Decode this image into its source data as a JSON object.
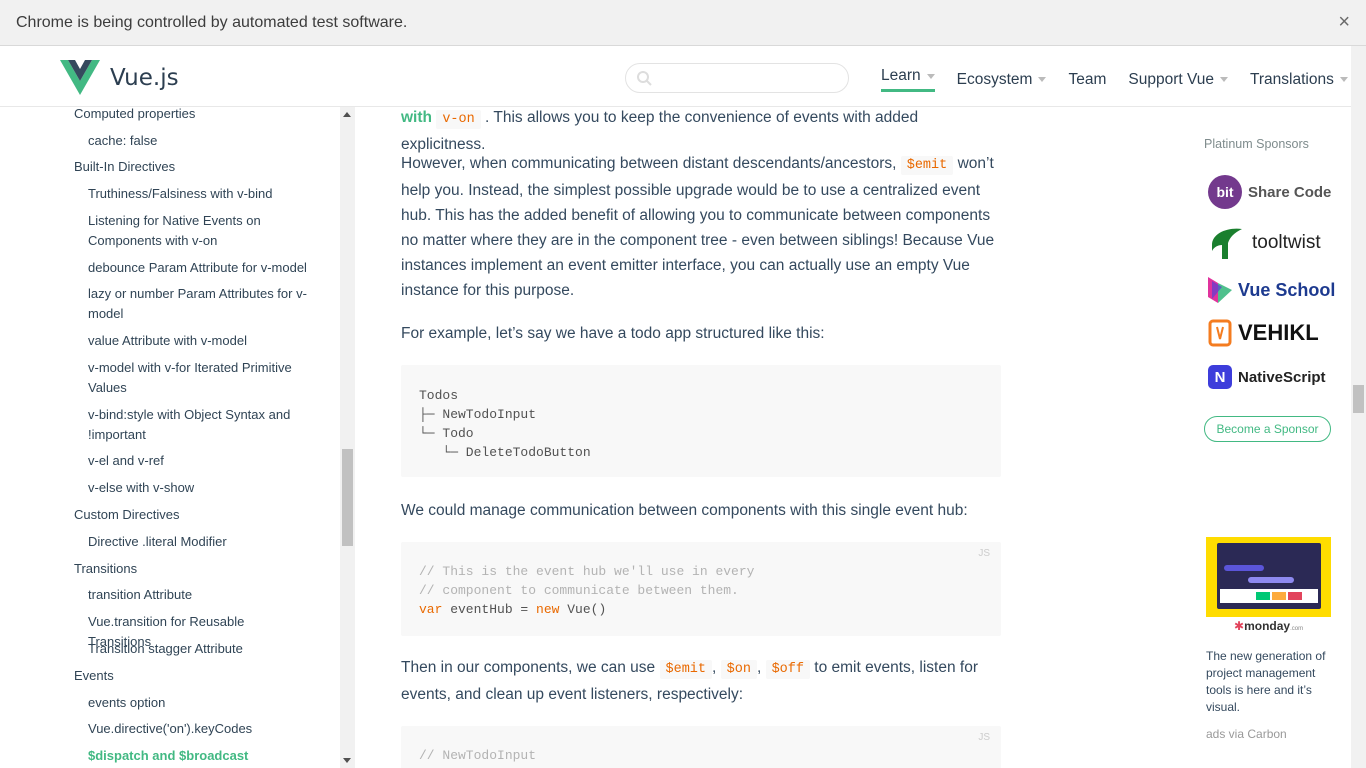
{
  "infobar": {
    "message": "Chrome is being controlled by automated test software.",
    "close_glyph": "×"
  },
  "header": {
    "brand": "Vue.js",
    "search_placeholder": "",
    "nav": [
      {
        "label": "Learn",
        "has_caret": true,
        "active": true
      },
      {
        "label": "Ecosystem",
        "has_caret": true
      },
      {
        "label": "Team",
        "has_caret": false
      },
      {
        "label": "Support Vue",
        "has_caret": true
      },
      {
        "label": "Translations",
        "has_caret": true
      }
    ]
  },
  "sidebar": {
    "items": [
      {
        "label": "Computed properties",
        "level": "section"
      },
      {
        "label": "cache: false",
        "level": "sub"
      },
      {
        "label": "Built-In Directives",
        "level": "section"
      },
      {
        "label": "Truthiness/Falsiness with v-bind",
        "level": "sub"
      },
      {
        "label": "Listening for Native Events on Components with v-on",
        "level": "sub"
      },
      {
        "label": "debounce Param Attribute for v-model",
        "level": "sub"
      },
      {
        "label": "lazy or number Param Attributes for v-model",
        "level": "sub"
      },
      {
        "label": "value Attribute with v-model",
        "level": "sub"
      },
      {
        "label": "v-model with v-for Iterated Primitive Values",
        "level": "sub"
      },
      {
        "label": "v-bind:style with Object Syntax and !important",
        "level": "sub"
      },
      {
        "label": "v-el and v-ref",
        "level": "sub"
      },
      {
        "label": "v-else with v-show",
        "level": "sub"
      },
      {
        "label": "Custom Directives",
        "level": "section"
      },
      {
        "label": "Directive .literal Modifier",
        "level": "sub"
      },
      {
        "label": "Transitions",
        "level": "section"
      },
      {
        "label": "transition Attribute",
        "level": "sub"
      },
      {
        "label": "Vue.transition for Reusable Transitions",
        "level": "sub"
      },
      {
        "label": "Transition stagger Attribute",
        "level": "sub"
      },
      {
        "label": "Events",
        "level": "section"
      },
      {
        "label": "events option",
        "level": "sub"
      },
      {
        "label": "Vue.directive('on').keyCodes",
        "level": "sub"
      },
      {
        "label": "$dispatch and $broadcast",
        "level": "sub",
        "active": true
      }
    ]
  },
  "content": {
    "p0": {
      "link_text": "with",
      "code": "v-on",
      "rest": ". This allows you to keep the convenience of events with added explicitness."
    },
    "p1": {
      "before": "However, when communicating between distant descendants/ancestors,",
      "code": "$emit",
      "after": "won’t help you. Instead, the simplest possible upgrade would be to use a centralized event hub. This has the added benefit of allowing you to communicate between components no matter where they are in the component tree - even between siblings! Because Vue instances implement an event emitter interface, you can actually use an empty Vue instance for this purpose."
    },
    "p2": "For example, let’s say we have a todo app structured like this:",
    "tree": [
      "Todos",
      "├─ NewTodoInput",
      "└─ Todo",
      "   └─ DeleteTodoButton"
    ],
    "p3": "We could manage communication between components with this single event hub:",
    "code1": {
      "lang": "JS",
      "comment1": "// This is the event hub we'll use in every",
      "comment2": "// component to communicate between them.",
      "kw_var": "var",
      "mid": " eventHub = ",
      "kw_new": "new",
      "end": " Vue()"
    },
    "p4": {
      "before": "Then in our components, we can use",
      "code1": "$emit",
      "sep1": ",",
      "code2": "$on",
      "sep2": ",",
      "code3": "$off",
      "after": "to emit events, listen for events, and clean up event listeners, respectively:"
    },
    "code2": {
      "lang": "JS",
      "comment": "// NewTodoInput"
    }
  },
  "aside": {
    "title": "Platinum Sponsors",
    "sponsors": [
      {
        "name": "Share Code",
        "badge": "bit",
        "icon": "bit-logo-icon",
        "color": "#73398d"
      },
      {
        "name": "tooltwist",
        "icon": "tooltwist-logo-icon",
        "color": "#1a7f2e"
      },
      {
        "name": "Vue School",
        "icon": "vueschool-logo-icon",
        "color": "#1d3a8f"
      },
      {
        "name": "VEHIKL",
        "icon": "vehikl-logo-icon",
        "color": "#f47c20"
      },
      {
        "name": "NativeScript",
        "badge": "N",
        "icon": "nativescript-logo-icon",
        "color": "#3d3ddb"
      }
    ],
    "become_sponsor": "Become a Sponsor",
    "ad_brand": "monday",
    "ad_brand_suffix": ".com",
    "ad_text": "The new generation of project management tools is here and it’s visual.",
    "ad_via": "ads via Carbon"
  },
  "colors": {
    "accent": "#42b983",
    "text": "#34495e",
    "code_inline": "#e96900",
    "code_bg": "#f8f8f8"
  }
}
